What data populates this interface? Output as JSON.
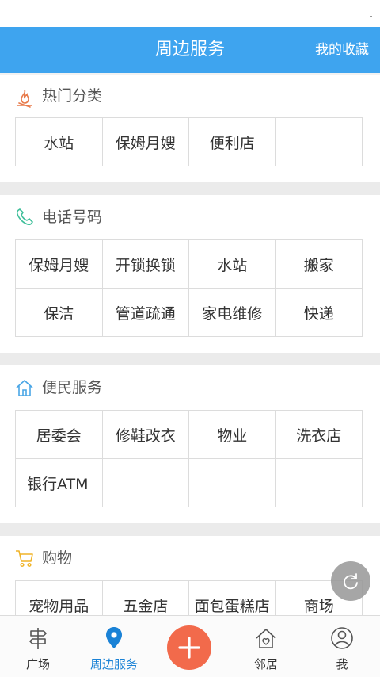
{
  "header": {
    "title": "周边服务",
    "favorites_label": "我的收藏"
  },
  "sections": [
    {
      "title": "热门分类",
      "icon": "fire-icon",
      "items": [
        "水站",
        "保姆月嫂",
        "便利店",
        ""
      ]
    },
    {
      "title": "电话号码",
      "icon": "phone-icon",
      "items": [
        "保姆月嫂",
        "开锁换锁",
        "水站",
        "搬家",
        "保洁",
        "管道疏通",
        "家电维修",
        "快递"
      ]
    },
    {
      "title": "便民服务",
      "icon": "house-icon",
      "items": [
        "居委会",
        "修鞋改衣",
        "物业",
        "洗衣店",
        "银行ATM",
        "",
        "",
        ""
      ]
    },
    {
      "title": "购物",
      "icon": "shopping-cart-icon",
      "items": [
        "宠物用品",
        "五金店",
        "面包蛋糕店",
        "商场"
      ]
    }
  ],
  "tabbar": {
    "tabs": [
      {
        "label": "广场",
        "icon": "signpost-icon"
      },
      {
        "label": "周边服务",
        "icon": "location-pin-icon"
      },
      {
        "label": "",
        "icon": "plus-icon"
      },
      {
        "label": "邻居",
        "icon": "neighbor-house-icon"
      },
      {
        "label": "我",
        "icon": "user-icon"
      }
    ],
    "active_tab": "周边服务"
  },
  "colors": {
    "header": "#3ea4ef",
    "active_tab": "#1a82d6",
    "plus_button": "#f26a4b",
    "separator": "#ebebeb"
  }
}
